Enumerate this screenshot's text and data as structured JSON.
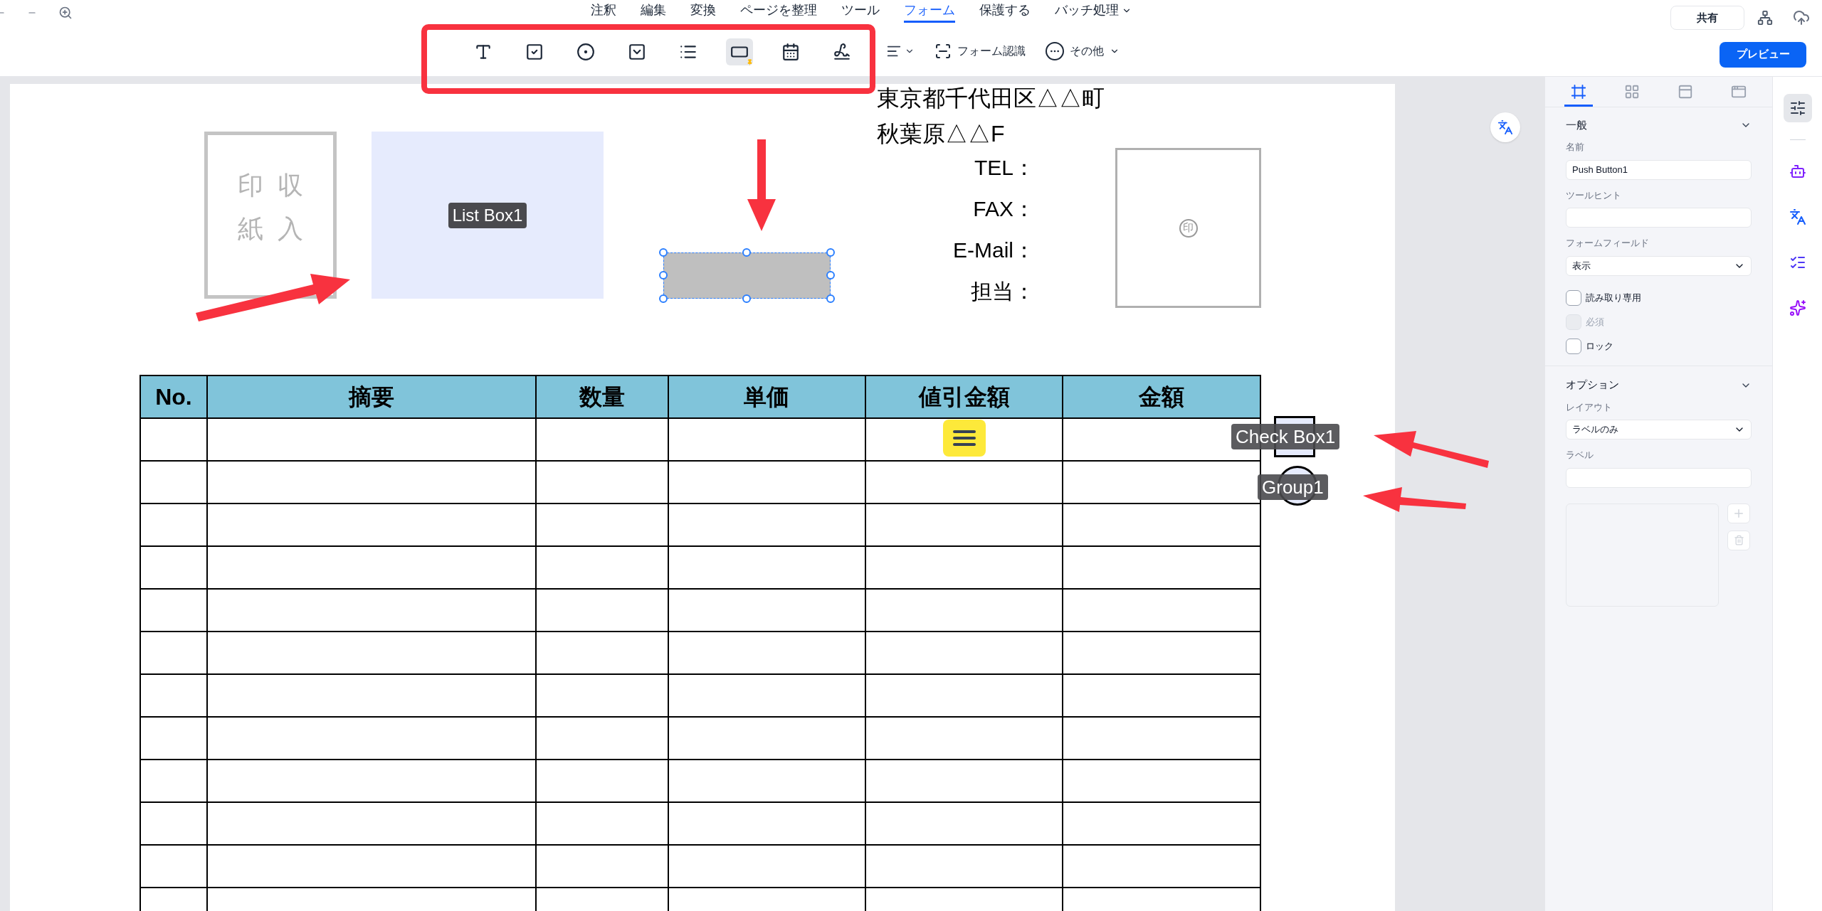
{
  "menu_tabs": [
    {
      "label": "注釈",
      "selected": false,
      "dropdown": false
    },
    {
      "label": "編集",
      "selected": false,
      "dropdown": false
    },
    {
      "label": "変換",
      "selected": false,
      "dropdown": false
    },
    {
      "label": "ページを整理",
      "selected": false,
      "dropdown": false
    },
    {
      "label": "ツール",
      "selected": false,
      "dropdown": false
    },
    {
      "label": "フォーム",
      "selected": true,
      "dropdown": false
    },
    {
      "label": "保護する",
      "selected": false,
      "dropdown": false
    },
    {
      "label": "バッチ処理",
      "selected": false,
      "dropdown": true
    }
  ],
  "form_tools": [
    {
      "kind": "text_field",
      "selected": false,
      "pinned": false
    },
    {
      "kind": "check_box",
      "selected": false,
      "pinned": false
    },
    {
      "kind": "radio_button",
      "selected": false,
      "pinned": false
    },
    {
      "kind": "combo_box",
      "selected": false,
      "pinned": false
    },
    {
      "kind": "list_box",
      "selected": false,
      "pinned": false
    },
    {
      "kind": "push_button",
      "selected": true,
      "pinned": true
    },
    {
      "kind": "date",
      "selected": false,
      "pinned": false
    },
    {
      "kind": "signature",
      "selected": false,
      "pinned": false
    }
  ],
  "toolbar_actions": [
    {
      "kind": "align"
    },
    {
      "kind": "recognize",
      "label": "フォーム認識"
    },
    {
      "kind": "more",
      "label": "その他"
    }
  ],
  "share_button": "共有",
  "preview_button": "プレビュー",
  "document": {
    "stamp_box": "収入印紙",
    "list_box_label": "List Box1",
    "address_lines": [
      "東京都千代田区△△町",
      "秋葉原△△F"
    ],
    "contact_labels": [
      "TEL：",
      "FAX：",
      "E-Mail：",
      "担当："
    ],
    "seal": "印",
    "check_box_label": "Check Box1",
    "radio_group_label": "Group1",
    "table": {
      "columns": [
        "No.",
        "摘要",
        "数量",
        "単価",
        "値引金額",
        "金額"
      ],
      "rows": [
        {
          "kind": "empty"
        },
        {
          "kind": "empty"
        },
        {
          "kind": "empty"
        },
        {
          "kind": "empty"
        },
        {
          "kind": "empty"
        },
        {
          "kind": "empty"
        },
        {
          "kind": "empty"
        },
        {
          "kind": "empty"
        },
        {
          "kind": "empty"
        },
        {
          "kind": "empty"
        },
        {
          "kind": "empty"
        },
        {
          "kind": "empty"
        }
      ]
    }
  },
  "properties": {
    "tabs": [
      {
        "kind": "general",
        "selected": true
      },
      {
        "kind": "appearance",
        "selected": false
      },
      {
        "kind": "options",
        "selected": false
      },
      {
        "kind": "actions",
        "selected": false
      }
    ],
    "general": {
      "title": "一般",
      "expanded": true,
      "name_label": "名前",
      "name_value": "Push Button1",
      "tooltip_label": "ツールヒント",
      "form_field_label": "フォームフィールド",
      "form_field_value": "表示",
      "checkboxes": [
        {
          "label": "読み取り専用",
          "checked": false,
          "disabled": false
        },
        {
          "label": "必須",
          "checked": false,
          "disabled": true
        },
        {
          "label": "ロック",
          "checked": false,
          "disabled": false
        }
      ]
    },
    "options": {
      "title": "オプション",
      "expanded": true,
      "layout_label": "レイアウト",
      "layout_value": "ラベルのみ",
      "label_label": "ラベル"
    }
  },
  "rail": [
    {
      "kind": "properties",
      "selected": true
    },
    {
      "kind": "assistant",
      "selected": false
    },
    {
      "kind": "translate",
      "selected": false
    },
    {
      "kind": "task",
      "selected": false
    },
    {
      "kind": "ai",
      "selected": false
    }
  ]
}
